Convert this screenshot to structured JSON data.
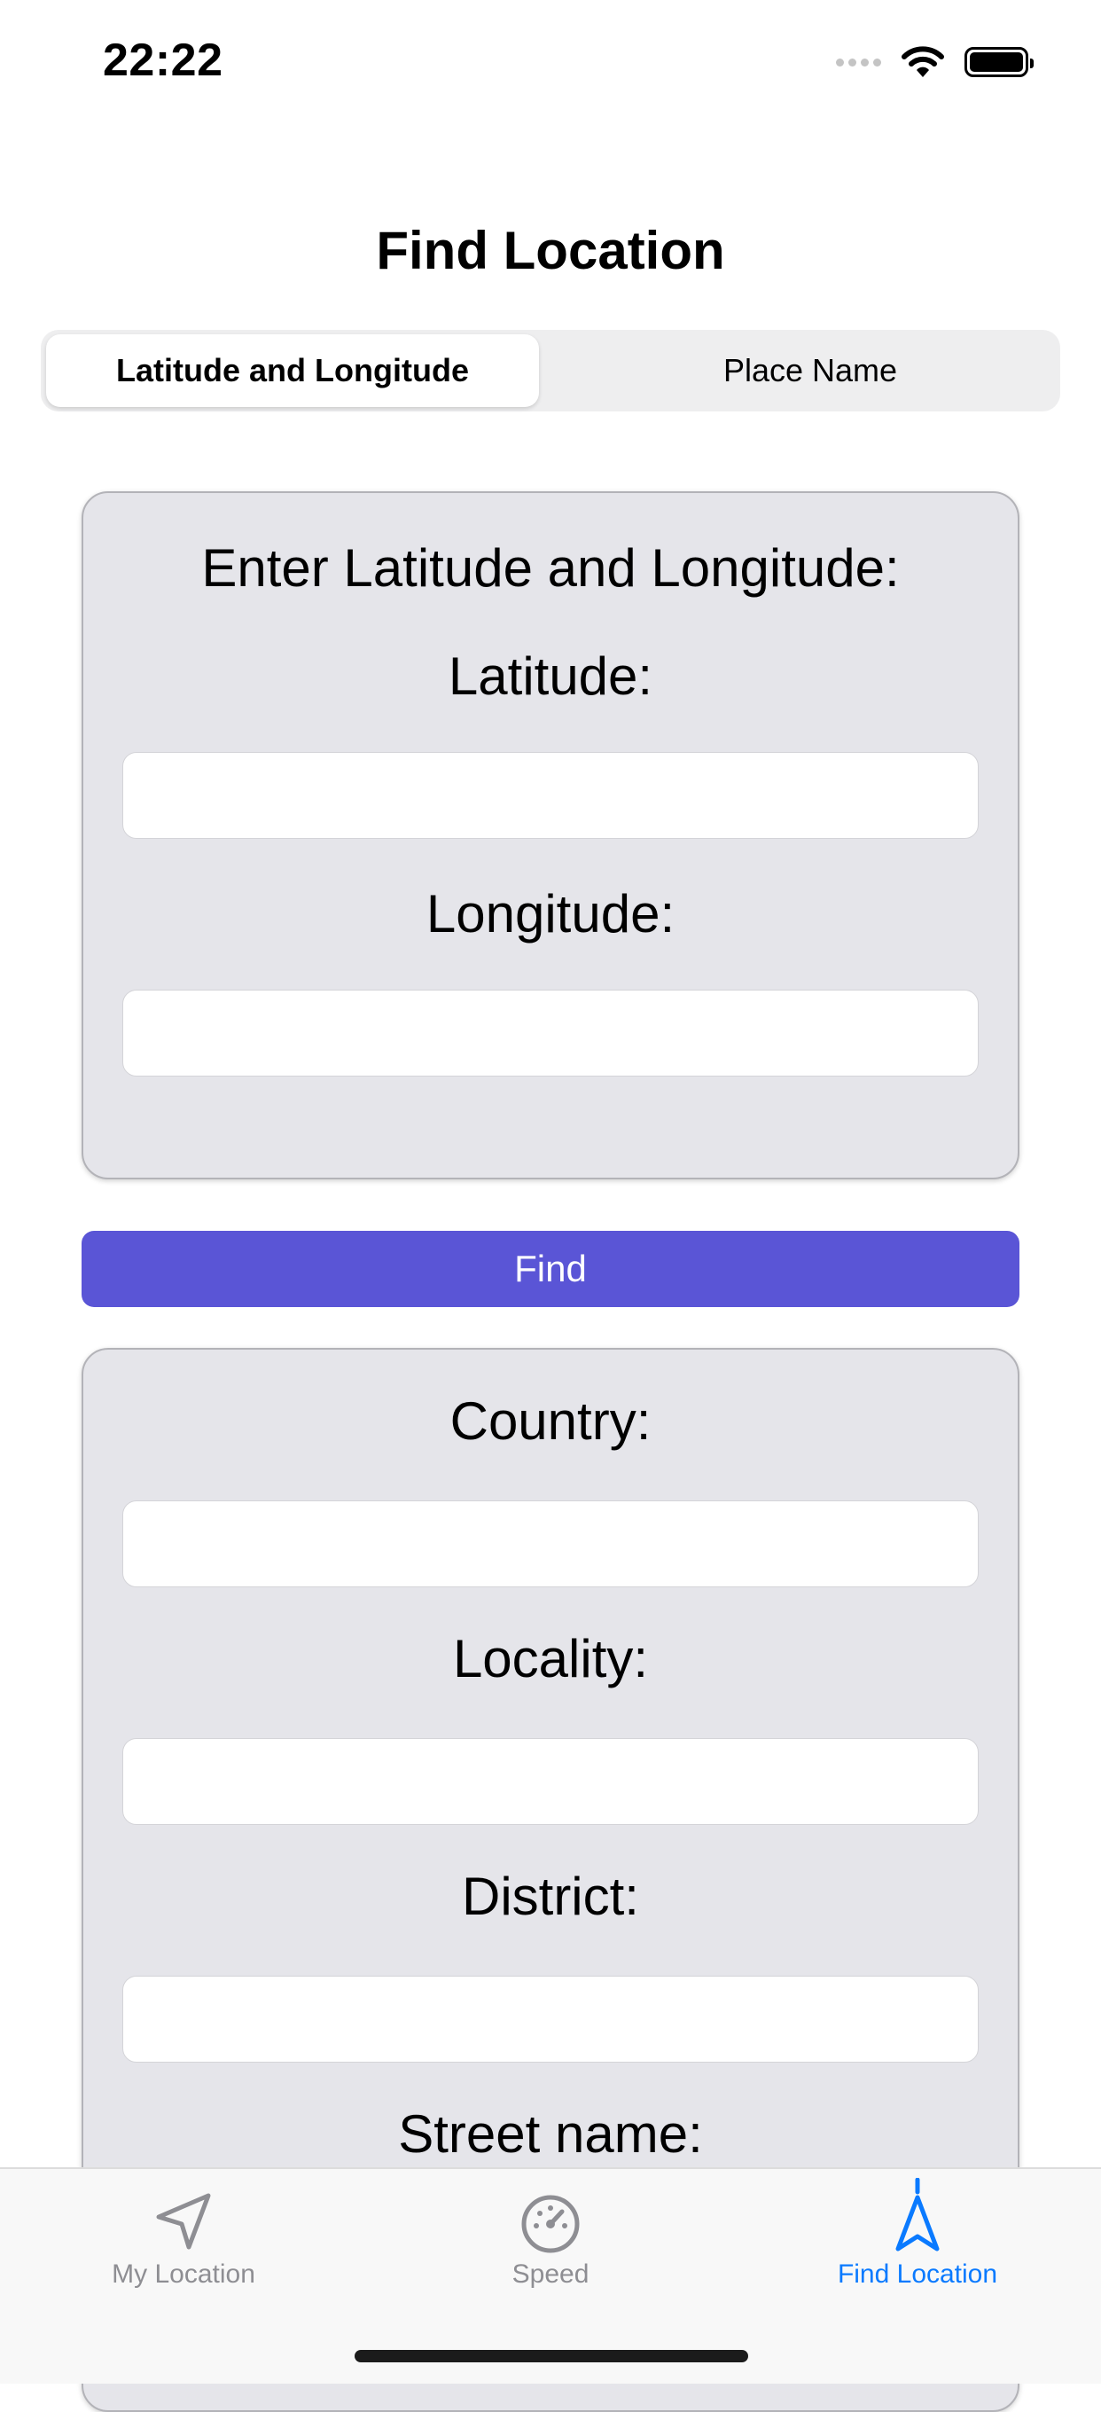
{
  "status_bar": {
    "time": "22:22"
  },
  "navigation": {
    "title": "Find Location"
  },
  "segmented_control": {
    "selected_index": 0,
    "options": [
      "Latitude and Longitude",
      "Place Name"
    ]
  },
  "coordinates_card": {
    "heading": "Enter Latitude and Longitude:",
    "latitude_label": "Latitude:",
    "latitude_value": "",
    "longitude_label": "Longitude:",
    "longitude_value": ""
  },
  "find_button": {
    "label": "Find"
  },
  "result_card": {
    "country_label": "Country:",
    "country_value": "",
    "locality_label": "Locality:",
    "locality_value": "",
    "district_label": "District:",
    "district_value": "",
    "street_label": "Street name:"
  },
  "tab_bar": {
    "active_index": 2,
    "accent_color": "#0a7aff",
    "inactive_color": "#8e8e93",
    "items": [
      {
        "label": "My Location",
        "icon": "location-arrow-icon"
      },
      {
        "label": "Speed",
        "icon": "speedometer-icon"
      },
      {
        "label": "Find Location",
        "icon": "navigation-arrow-icon"
      }
    ]
  },
  "colors": {
    "button": "#5a55d6",
    "card_background": "#e5e5ea"
  }
}
